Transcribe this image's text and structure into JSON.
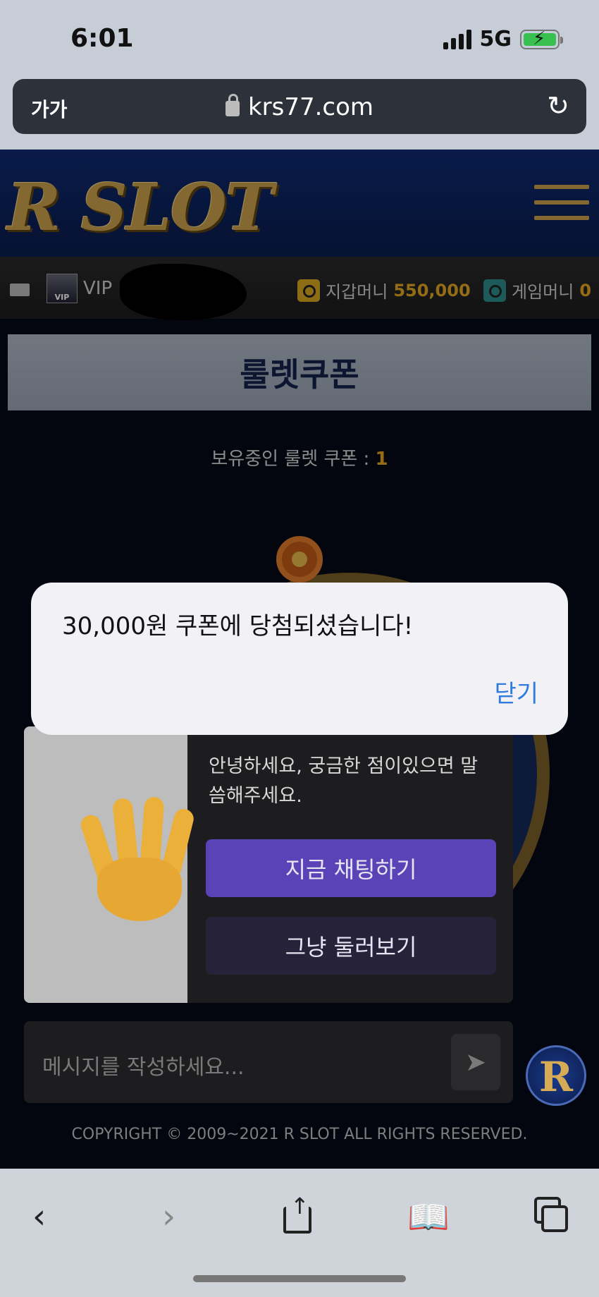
{
  "status_bar": {
    "time": "6:01",
    "network": "5G"
  },
  "browser": {
    "text_size_button": "가가",
    "url": "krs77.com"
  },
  "site": {
    "logo": "R SLOT",
    "user_bar": {
      "vip_badge": "VIP",
      "vip_label": "VIP",
      "wallet_label": "지갑머니",
      "wallet_amount": "550,000",
      "game_label": "게임머니",
      "game_amount": "0"
    },
    "page_title": "룰렛쿠폰",
    "coupon_label": "보유중인 룰렛 쿠폰 : ",
    "coupon_count": "1",
    "copyright": "COPYRIGHT © 2009~2021 R SLOT ALL RIGHTS RESERVED.",
    "avatar_letter": "R"
  },
  "chat": {
    "greeting": "안녕하세요, 궁금한 점이있으면 말씀해주세요.",
    "primary_button": "지금 채팅하기",
    "secondary_button": "그냥 둘러보기",
    "input_placeholder": "메시지를 작성하세요..."
  },
  "alert": {
    "message": "30,000원 쿠폰에 당첨되셨습니다!",
    "close_label": "닫기"
  },
  "icons": [
    "signal-icon",
    "battery-icon",
    "lock-icon",
    "reload-icon",
    "menu-icon",
    "mail-icon",
    "safe-icon",
    "hand-icon",
    "send-icon",
    "back-icon",
    "forward-icon",
    "share-icon",
    "bookmarks-icon",
    "tabs-icon"
  ],
  "colors": {
    "accent_gold": "#e3a723",
    "chat_primary": "#5943b6",
    "link_blue": "#2f7bde",
    "header_blue": "#0e2a72"
  }
}
